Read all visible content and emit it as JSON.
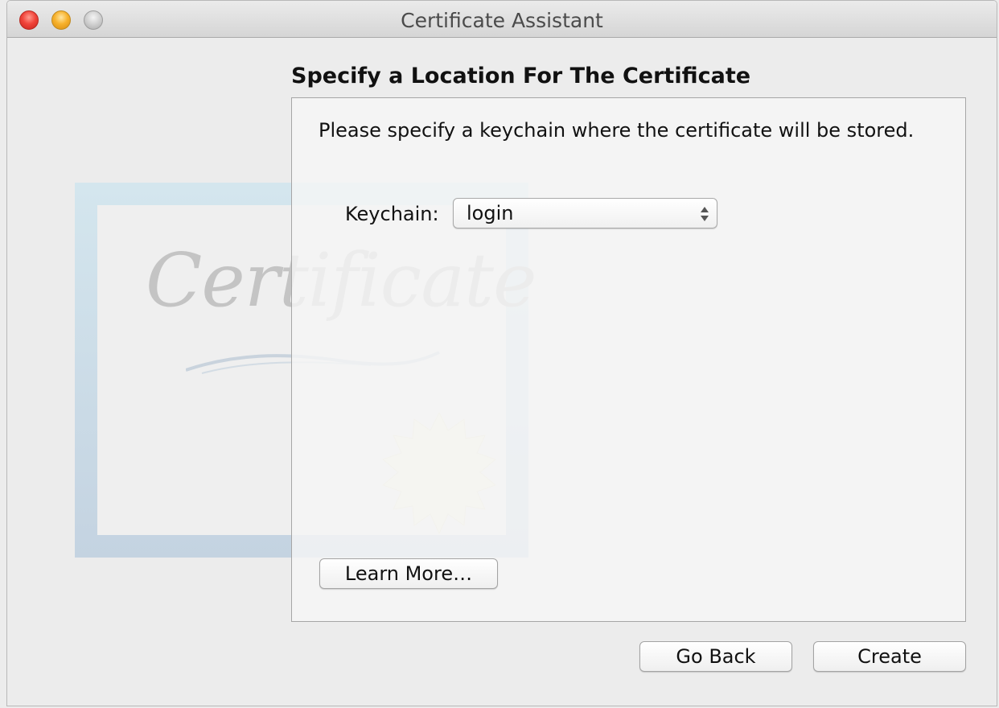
{
  "window": {
    "title": "Certificate Assistant"
  },
  "step": {
    "heading": "Specify a Location For The Certificate",
    "instruction": "Please specify a keychain where the certificate will be stored."
  },
  "keychain": {
    "label": "Keychain:",
    "selected": "login"
  },
  "certificate_graphic": {
    "word": "Certificate"
  },
  "buttons": {
    "learn_more": "Learn More…",
    "go_back": "Go Back",
    "create": "Create"
  },
  "colors": {
    "close": "#f1453b",
    "minimize": "#f7b22d",
    "zoom": "#cfcfcf"
  }
}
